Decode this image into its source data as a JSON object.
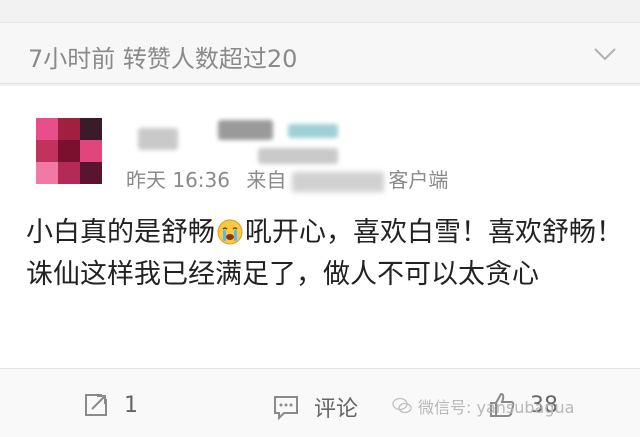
{
  "header": {
    "text": "7小时前 转赞人数超过20"
  },
  "post": {
    "time": "昨天 16:36",
    "source_prefix": "来自",
    "source_suffix": "客户端",
    "text_part1": "小白真的是舒畅",
    "text_part2": "吼开心，喜欢白雪！喜欢舒畅！诛仙这样我已经满足了，做人不可以太贪心"
  },
  "actions": {
    "repost_count": "1",
    "comment_label": "评论",
    "like_count": "38"
  },
  "watermark": "微信号: yansubagua",
  "colors": {
    "avatar": [
      "#e84f8a",
      "#a0213f",
      "#3b1a2a",
      "#c2325e",
      "#7a0f2e",
      "#e0467c",
      "#f07aa5",
      "#b22a55",
      "#5a1430"
    ]
  }
}
